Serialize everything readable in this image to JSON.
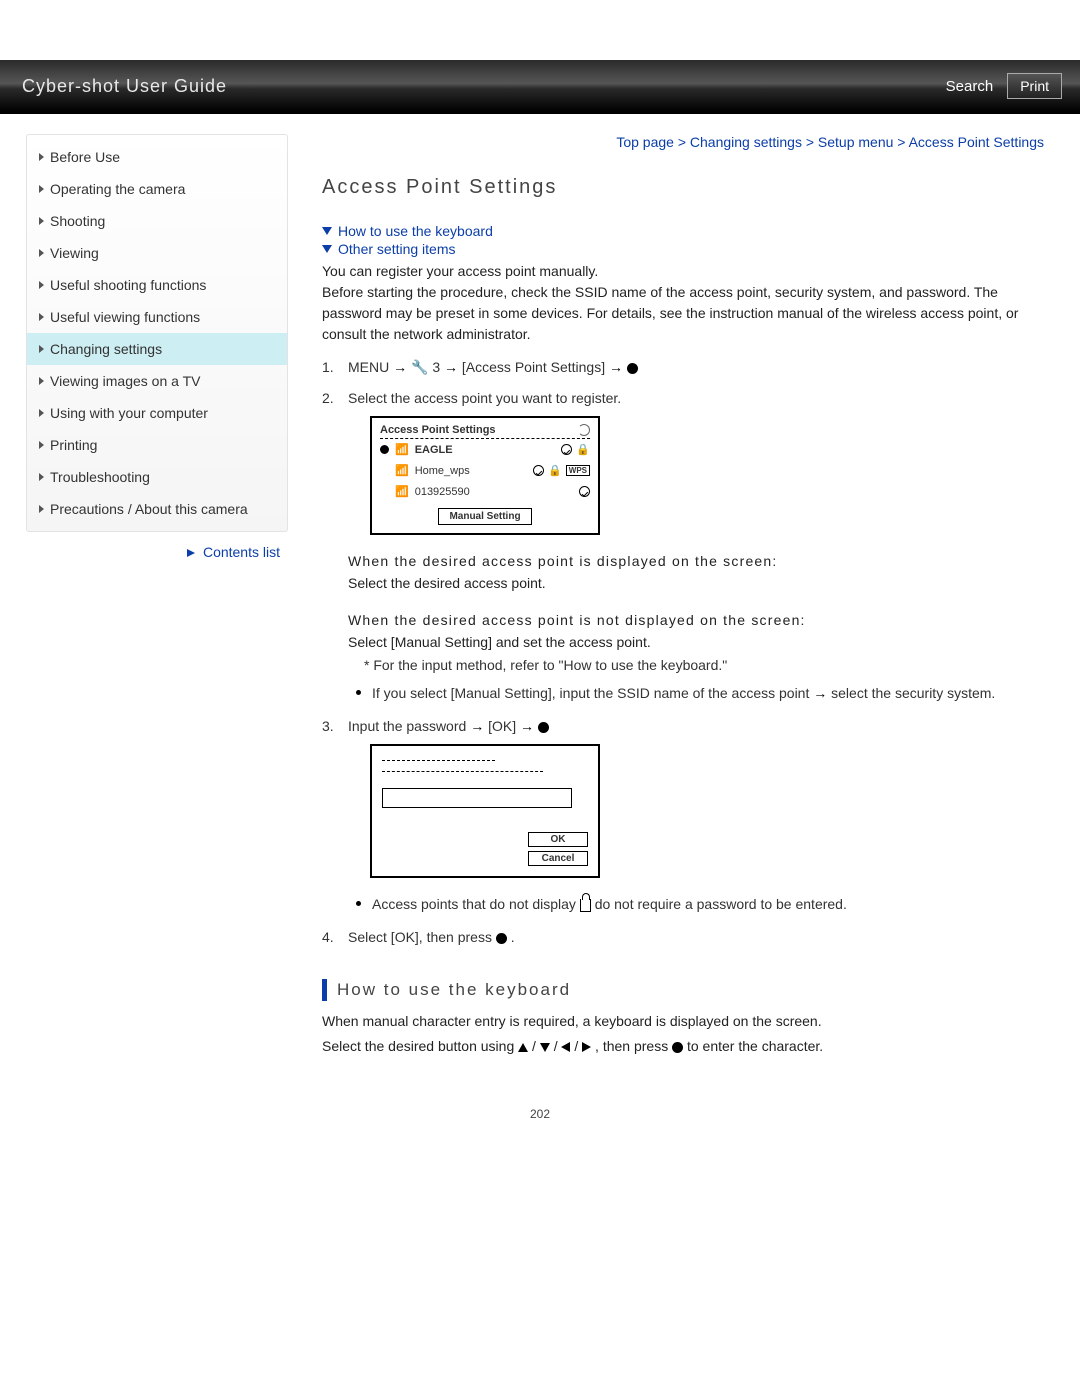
{
  "header": {
    "title": "Cyber-shot User Guide",
    "search": "Search",
    "print": "Print"
  },
  "sidebar": {
    "items": [
      "Before Use",
      "Operating the camera",
      "Shooting",
      "Viewing",
      "Useful shooting functions",
      "Useful viewing functions",
      "Changing settings",
      "Viewing images on a TV",
      "Using with your computer",
      "Printing",
      "Troubleshooting",
      "Precautions / About this camera"
    ],
    "active_index": 6,
    "contents_list": "Contents list"
  },
  "breadcrumb": "Top page > Changing settings > Setup menu > Access Point Settings",
  "page_title": "Access Point Settings",
  "anchors": {
    "keyboard": "How to use the keyboard",
    "other": "Other setting items"
  },
  "intro": "You can register your access point manually.\nBefore starting the procedure, check the SSID name of the access point, security system, and password. The password may be preset in some devices. For details, see the instruction manual of the wireless access point, or consult the network administrator.",
  "step1": {
    "menu": "MENU",
    "num": "3",
    "item": "[Access Point Settings]"
  },
  "step2": "Select the access point you want to register.",
  "aps_figure": {
    "title": "Access Point Settings",
    "rows": [
      {
        "name": "EAGLE",
        "selected": true,
        "lock": true,
        "wps": false
      },
      {
        "name": "Home_wps",
        "selected": false,
        "lock": true,
        "wps": true
      },
      {
        "name": "013925590",
        "selected": false,
        "lock": false,
        "wps": false
      }
    ],
    "manual": "Manual Setting"
  },
  "sub_displayed": "When the desired access point is displayed on the screen:",
  "sub_displayed_body": "Select the desired access point.",
  "sub_not_displayed": "When the desired access point is not displayed on the screen:",
  "sub_not_displayed_body": "Select [Manual Setting] and set the access point.",
  "note_star": "* For the input method, refer to \"How to use the keyboard.\"",
  "bullet_manual_a": "If you select [Manual Setting], input the SSID name of the access point",
  "bullet_manual_b": "select the security system.",
  "step3_a": "Input the password",
  "step3_b": "[OK]",
  "fig2": {
    "ok": "OK",
    "cancel": "Cancel"
  },
  "bullet_lock_a": "Access points that do not display",
  "bullet_lock_b": "do not require a password to be entered.",
  "step4": "Select [OK], then press",
  "section_keyboard_title": "How to use the keyboard",
  "keyboard_p1": "When manual character entry is required, a keyboard is displayed on the screen.",
  "keyboard_p2a": "Select the desired button using",
  "keyboard_p2b": ", then press",
  "keyboard_p2c": "to enter the character.",
  "page_number": "202"
}
